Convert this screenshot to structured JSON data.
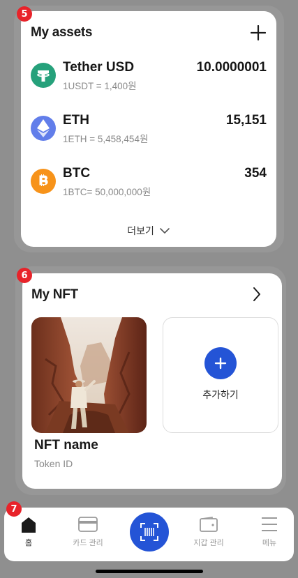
{
  "steps": {
    "assets": "5",
    "nft": "6",
    "nav": "7"
  },
  "assets": {
    "title": "My assets",
    "items": [
      {
        "name": "Tether USD",
        "rate": "1USDT = 1,400원",
        "value": "10.0000001",
        "icon": "tether-icon",
        "color": "#26a17b"
      },
      {
        "name": "ETH",
        "rate": "1ETH = 5,458,454원",
        "value": "15,151",
        "icon": "ethereum-icon",
        "color": "#627eea"
      },
      {
        "name": "BTC",
        "rate": "1BTC= 50,000,000원",
        "value": "354",
        "icon": "bitcoin-icon",
        "color": "#f7931a"
      }
    ],
    "more_label": "더보기"
  },
  "nft": {
    "title": "My NFT",
    "item": {
      "name": "NFT name",
      "token_id": "Token ID"
    },
    "add_label": "추가하기"
  },
  "nav": {
    "items": [
      {
        "label": "홈",
        "icon": "home-icon"
      },
      {
        "label": "카드 관리",
        "icon": "card-icon"
      },
      {
        "label": "",
        "icon": "barcode-scan-icon"
      },
      {
        "label": "지갑 관리",
        "icon": "wallet-icon"
      },
      {
        "label": "메뉴",
        "icon": "menu-icon"
      }
    ]
  },
  "colors": {
    "accent": "#2454d6",
    "step_badge": "#e8232a"
  }
}
